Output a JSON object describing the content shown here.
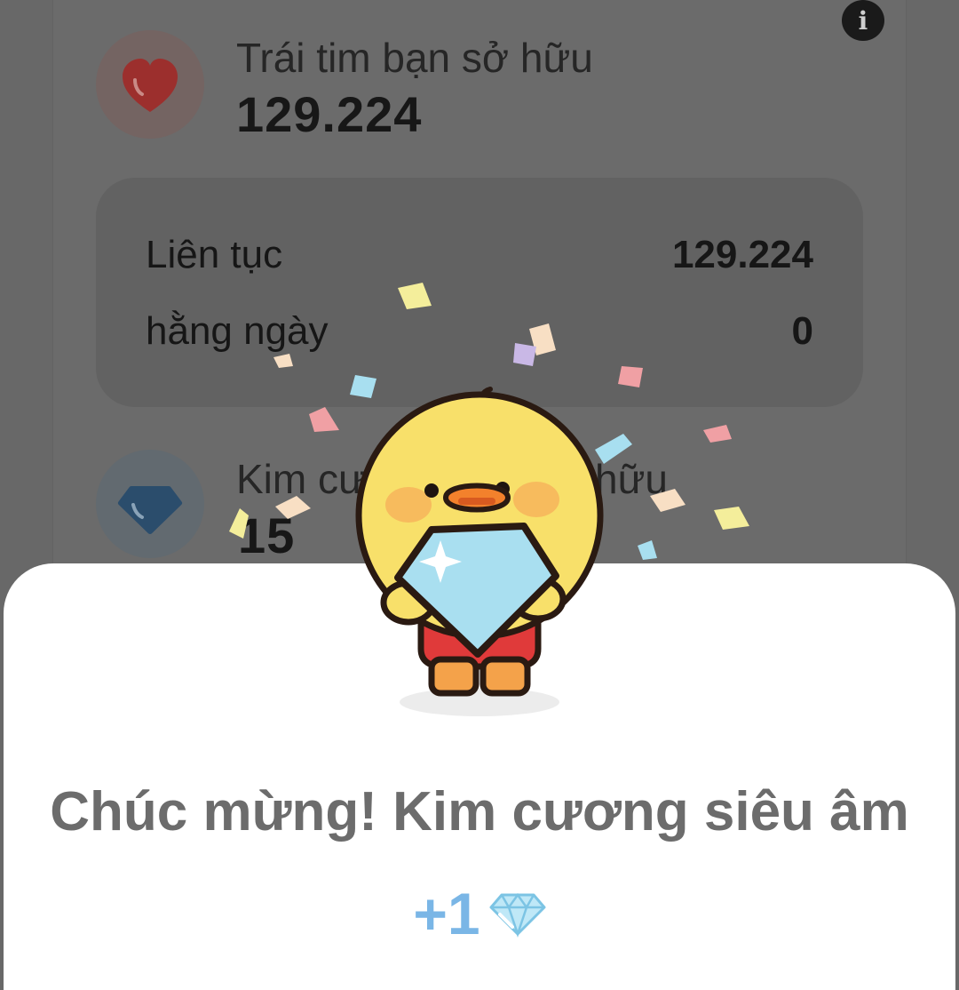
{
  "hearts": {
    "label": "Trái tim bạn sở hữu",
    "value": "129.224",
    "icon": "heart-icon"
  },
  "breakdown": {
    "rows": [
      {
        "label": "Liên tục",
        "value": "129.224"
      },
      {
        "label": "hằng ngày",
        "value": "0"
      }
    ]
  },
  "diamonds": {
    "label_start": "Kim cư",
    "label_end": "hữu",
    "value": "15",
    "icon": "diamond-icon"
  },
  "info_icon": "info-icon",
  "popup": {
    "title": "Chúc mừng! Kim cương siêu âm",
    "reward": "+1",
    "reward_icon": "diamond-icon",
    "illustration": "duck-holding-diamond"
  },
  "colors": {
    "overlay": "#686868",
    "heart": "#a0302e",
    "diamond": "#2e4f6e",
    "reward_text": "#7ab6e6",
    "title_text": "#6c6c6c"
  }
}
